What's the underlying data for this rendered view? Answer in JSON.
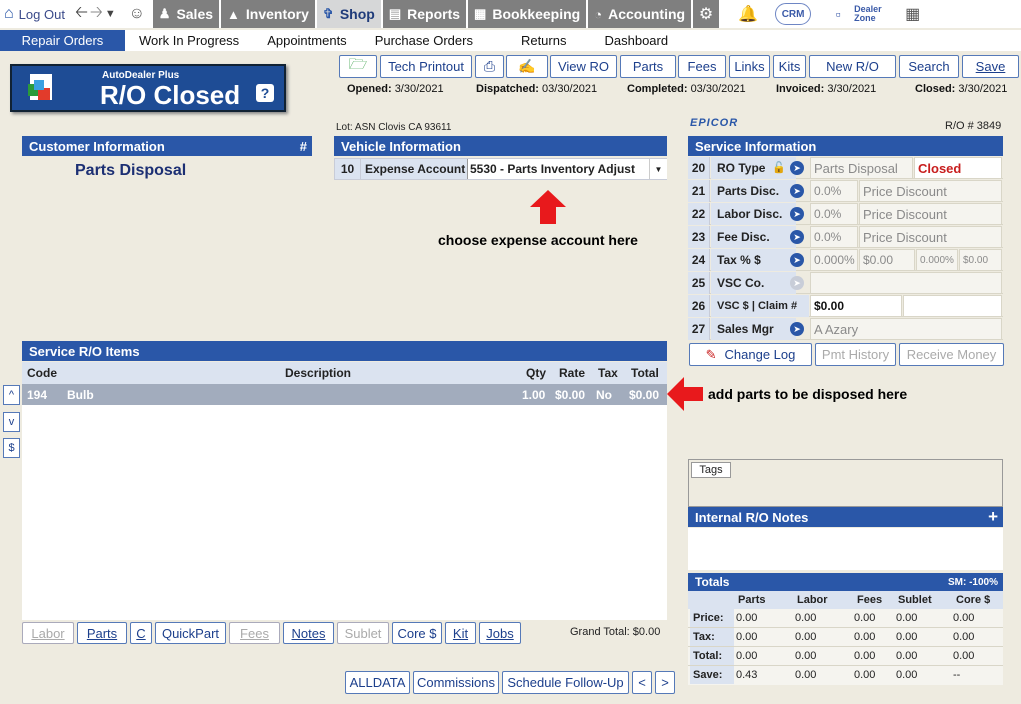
{
  "nav": {
    "logout": "Log Out",
    "tabs": [
      {
        "label": "Sales",
        "icon": "person-icon"
      },
      {
        "label": "Inventory",
        "icon": "car-icon"
      },
      {
        "label": "Shop",
        "icon": "wrench-icon"
      },
      {
        "label": "Reports",
        "icon": "report-icon"
      },
      {
        "label": "Bookkeeping",
        "icon": "book-icon"
      },
      {
        "label": "Accounting",
        "icon": "pie-chart-icon"
      }
    ],
    "crm": "CRM",
    "dealer_zone": "Dealer\nZone"
  },
  "subnav": [
    "Repair Orders",
    "Work In Progress",
    "Appointments",
    "Purchase Orders",
    "Returns",
    "Dashboard"
  ],
  "banner": {
    "sub": "AutoDealer Plus",
    "title": "R/O Closed",
    "help": "?"
  },
  "toolbar": {
    "tech_printout": "Tech Printout",
    "view_ro": "View RO",
    "parts": "Parts",
    "fees": "Fees",
    "links": "Links",
    "kits": "Kits",
    "new_ro": "New R/O",
    "search": "Search",
    "save": "Save"
  },
  "dates": {
    "opened_label": "Opened:",
    "opened": "3/30/2021",
    "dispatched_label": "Dispatched:",
    "dispatched": "03/30/2021",
    "completed_label": "Completed:",
    "completed": "03/30/2021",
    "invoiced_label": "Invoiced:",
    "invoiced": "3/30/2021",
    "closed_label": "Closed:",
    "closed": "3/30/2021"
  },
  "customer": {
    "header": "Customer Information",
    "hash": "#",
    "name": "Parts Disposal"
  },
  "vehicle": {
    "lot": "Lot: ASN Clovis CA 93611",
    "header": "Vehicle Information",
    "num": "10",
    "label": "Expense Account",
    "value": "5530 - Parts Inventory Adjust"
  },
  "annotations": {
    "expense": "choose expense account here",
    "parts": "add parts to be disposed here"
  },
  "brand": "EPICOR",
  "ro_number": "R/O # 3849",
  "service": {
    "header": "Service Information",
    "rows": [
      {
        "num": "20",
        "label": "RO Type",
        "v1": "Parts Disposal",
        "v2": "Closed"
      },
      {
        "num": "21",
        "label": "Parts Disc.",
        "v1": "0.0%",
        "v2": "Price Discount"
      },
      {
        "num": "22",
        "label": "Labor Disc.",
        "v1": "0.0%",
        "v2": "Price Discount"
      },
      {
        "num": "23",
        "label": "Fee Disc.",
        "v1": "0.0%",
        "v2": "Price Discount"
      },
      {
        "num": "24",
        "label": "Tax % $",
        "v1": "0.000%",
        "v2": "$0.00",
        "v3": "0.000%",
        "v4": "$0.00"
      },
      {
        "num": "25",
        "label": "VSC  Co."
      },
      {
        "num": "26",
        "label": "VSC $ | Claim #",
        "v1": "$0.00"
      },
      {
        "num": "27",
        "label": "Sales Mgr",
        "v1": "A Azary"
      }
    ],
    "change_log": "Change Log",
    "pmt_history": "Pmt History",
    "receive_money": "Receive Money"
  },
  "items": {
    "header": "Service R/O Items",
    "columns": [
      "Code",
      "Description",
      "Qty",
      "Rate",
      "Tax",
      "Total"
    ],
    "rows": [
      {
        "code": "194",
        "desc": "Bulb",
        "qty": "1.00",
        "rate": "$0.00",
        "tax": "No",
        "total": "$0.00"
      }
    ],
    "buttons": [
      "Labor",
      "Parts",
      "C",
      "QuickPart",
      "Fees",
      "Notes",
      "Sublet",
      "Core $",
      "Kit",
      "Jobs"
    ],
    "grand_total_label": "Grand Total:",
    "grand_total": "$0.00",
    "side": [
      "^",
      "v",
      "$"
    ]
  },
  "bottom": {
    "alldata": "ALLDATA",
    "commissions": "Commissions",
    "followup": "Schedule Follow-Up",
    "prev": "<",
    "next": ">"
  },
  "tags": "Tags",
  "notes": {
    "header": "Internal R/O Notes",
    "plus": "+"
  },
  "totals": {
    "header": "Totals",
    "sm": "SM: -100%",
    "columns": [
      "Parts",
      "Labor",
      "Fees",
      "Sublet",
      "Core $"
    ],
    "rows": [
      {
        "label": "Price:",
        "vals": [
          "0.00",
          "0.00",
          "0.00",
          "0.00",
          "0.00"
        ]
      },
      {
        "label": "Tax:",
        "vals": [
          "0.00",
          "0.00",
          "0.00",
          "0.00",
          "0.00"
        ]
      },
      {
        "label": "Total:",
        "vals": [
          "0.00",
          "0.00",
          "0.00",
          "0.00",
          "0.00"
        ]
      },
      {
        "label": "Save:",
        "vals": [
          "0.43",
          "0.00",
          "0.00",
          "0.00",
          "--"
        ]
      }
    ]
  }
}
